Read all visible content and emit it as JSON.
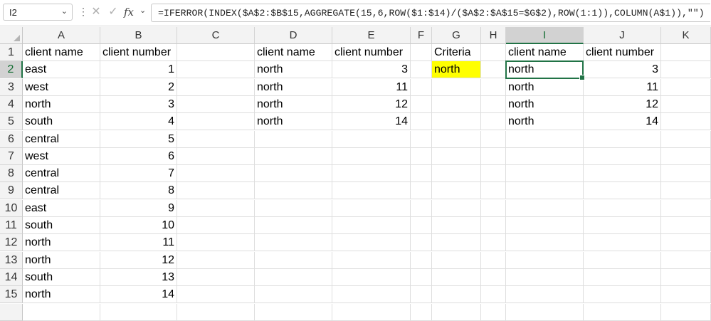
{
  "formula_bar": {
    "name_box": "I2",
    "formula": "=IFERROR(INDEX($A$2:$B$15,AGGREGATE(15,6,ROW($1:$14)/($A$2:$A$15=$G$2),ROW(1:1)),COLUMN(A$1)),\"\")",
    "cancel_icon": "cancel-x-icon",
    "enter_icon": "checkmark-icon",
    "function_label": "fx"
  },
  "columns": [
    "A",
    "B",
    "C",
    "D",
    "E",
    "F",
    "G",
    "H",
    "I",
    "J",
    "K"
  ],
  "rows": [
    "1",
    "2",
    "3",
    "4",
    "5",
    "6",
    "7",
    "8",
    "9",
    "10",
    "11",
    "12",
    "13",
    "14",
    "15"
  ],
  "cells": {
    "A1": "client name",
    "B1": "client number",
    "A2": "east",
    "B2": "1",
    "A3": "west",
    "B3": "2",
    "A4": "north",
    "B4": "3",
    "A5": "south",
    "B5": "4",
    "A6": "central",
    "B6": "5",
    "A7": "west",
    "B7": "6",
    "A8": "central",
    "B8": "7",
    "A9": "central",
    "B9": "8",
    "A10": "east",
    "B10": "9",
    "A11": "south",
    "B11": "10",
    "A12": "north",
    "B12": "11",
    "A13": "north",
    "B13": "12",
    "A14": "south",
    "B14": "13",
    "A15": "north",
    "B15": "14",
    "D1": "client name",
    "E1": "client number",
    "D2": "north",
    "E2": "3",
    "D3": "north",
    "E3": "11",
    "D4": "north",
    "E4": "12",
    "D5": "north",
    "E5": "14",
    "G1": "Criteria",
    "G2": "north",
    "I1": "client name",
    "J1": "client number",
    "I2": "north",
    "J2": "3",
    "I3": "north",
    "J3": "11",
    "I4": "north",
    "J4": "12",
    "I5": "north",
    "J5": "14"
  },
  "selected_cell": "I2",
  "highlight_color": "#ffff00",
  "accent_color": "#217346"
}
